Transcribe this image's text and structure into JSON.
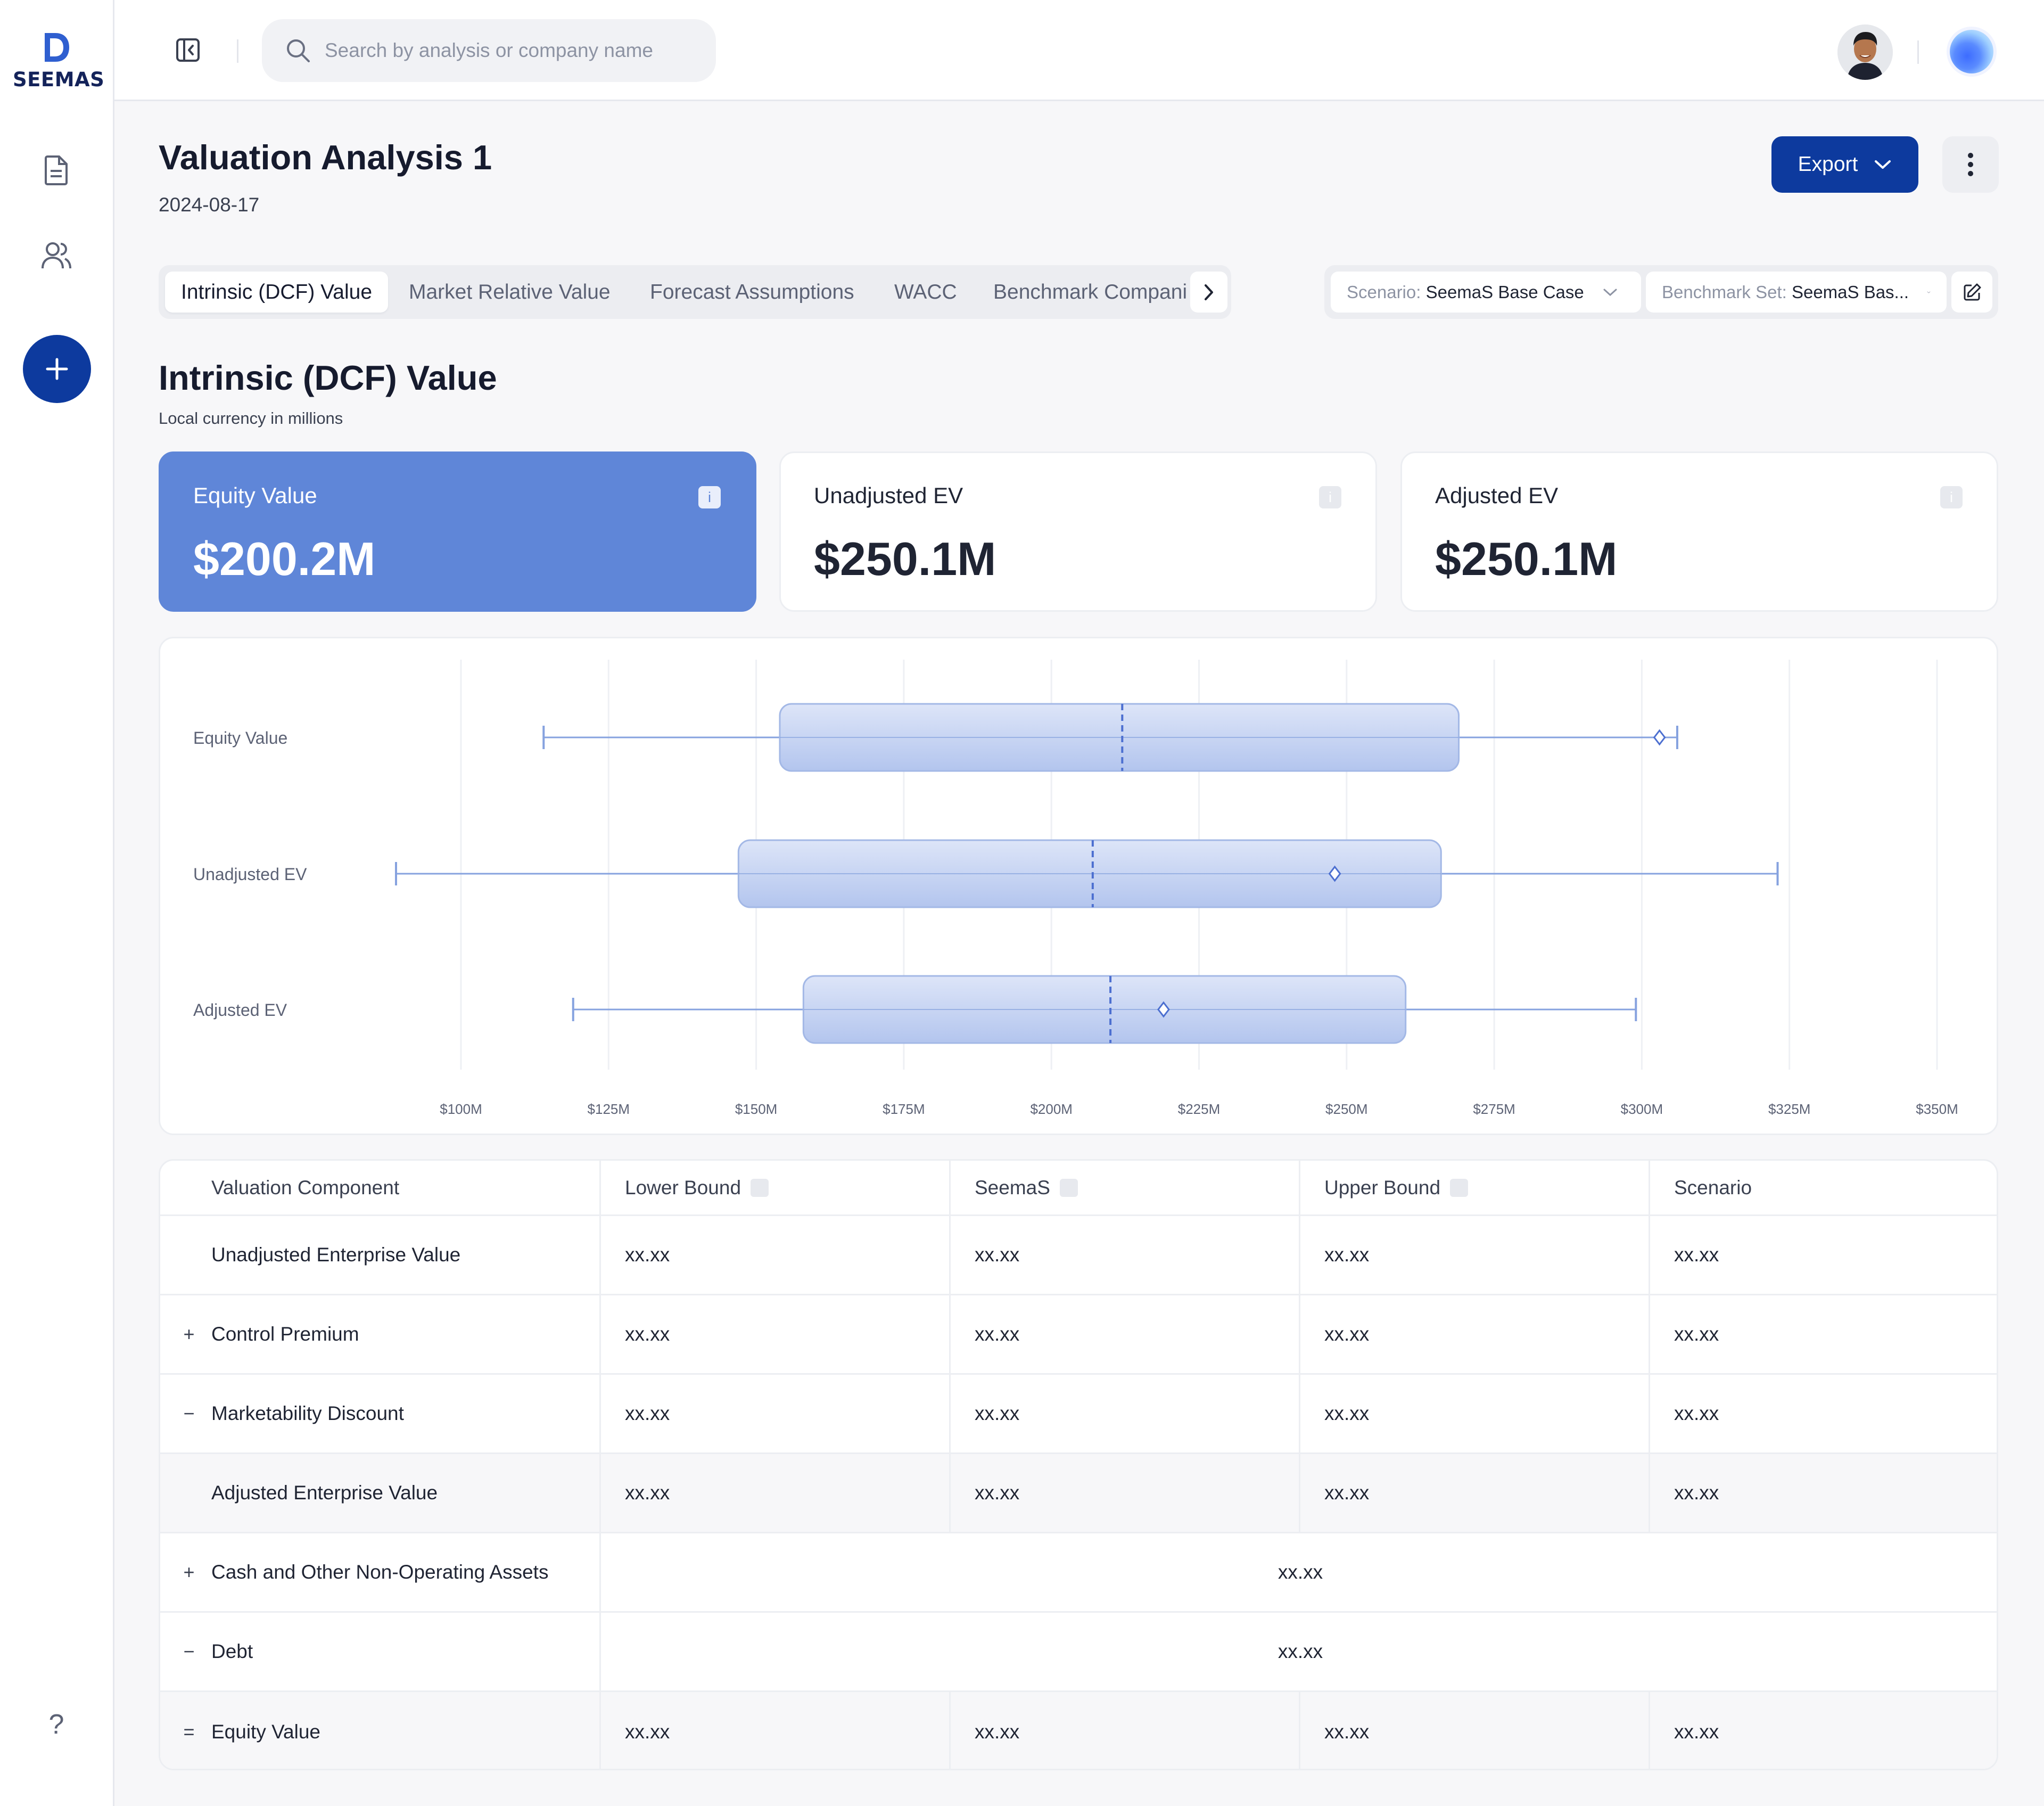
{
  "app": {
    "logo_text": "SEEMAS",
    "search_placeholder": "Search by analysis or company name"
  },
  "page": {
    "title": "Valuation Analysis 1",
    "date": "2024-08-17",
    "export_label": "Export"
  },
  "tabs": [
    {
      "label": "Intrinsic (DCF) Value",
      "active": true
    },
    {
      "label": "Market Relative Value",
      "active": false
    },
    {
      "label": "Forecast Assumptions",
      "active": false
    },
    {
      "label": "WACC",
      "active": false
    },
    {
      "label": "Benchmark Compani",
      "active": false
    }
  ],
  "filters": {
    "scenario_label": "Scenario:",
    "scenario_value": "SeemaS Base Case",
    "benchmark_label": "Benchmark Set:",
    "benchmark_value": "SeemaS Bas..."
  },
  "section": {
    "title": "Intrinsic (DCF) Value",
    "subtitle": "Local currency in millions"
  },
  "kpis": [
    {
      "label": "Equity Value",
      "value": "$200.2M",
      "info": "i"
    },
    {
      "label": "Unadjusted EV",
      "value": "$250.1M",
      "info": "i"
    },
    {
      "label": "Adjusted EV",
      "value": "$250.1M",
      "info": "i"
    }
  ],
  "chart_data": {
    "type": "boxplot",
    "orientation": "horizontal",
    "categories": [
      "Equity Value",
      "Unadjusted EV",
      "Adjusted EV"
    ],
    "x_ticks": [
      "$100M",
      "$125M",
      "$150M",
      "$175M",
      "$200M",
      "$225M",
      "$250M",
      "$275M",
      "$300M",
      "$325M",
      "$350M"
    ],
    "xlim": [
      100,
      350
    ],
    "grid": true,
    "series": [
      {
        "category": "Equity Value",
        "min": 114,
        "q1": 154,
        "median": 212,
        "q3": 269,
        "max": 306,
        "mean": 303
      },
      {
        "category": "Unadjusted EV",
        "min": 89,
        "q1": 147,
        "median": 207,
        "q3": 266,
        "max": 323,
        "mean": 248
      },
      {
        "category": "Adjusted EV",
        "min": 119,
        "q1": 158,
        "median": 210,
        "q3": 260,
        "max": 299,
        "mean": 219
      }
    ],
    "colors": {
      "box_fill": "#C9D6F3",
      "box_stroke": "#A3B8E6",
      "line": "#86A2DF",
      "median": "#4C6FD0",
      "grid": "#EEF0F4"
    }
  },
  "table": {
    "headers": [
      "Valuation Component",
      "Lower Bound",
      "SeemaS",
      "Upper Bound",
      "Scenario"
    ],
    "rows": [
      {
        "sign": "",
        "label": "Unadjusted Enterprise Value",
        "values": [
          "xx.xx",
          "xx.xx",
          "xx.xx",
          "xx.xx"
        ]
      },
      {
        "sign": "+",
        "label": "Control Premium",
        "values": [
          "xx.xx",
          "xx.xx",
          "xx.xx",
          "xx.xx"
        ]
      },
      {
        "sign": "−",
        "label": "Marketability Discount",
        "values": [
          "xx.xx",
          "xx.xx",
          "xx.xx",
          "xx.xx"
        ]
      },
      {
        "sign": "",
        "label": "Adjusted Enterprise Value",
        "values": [
          "xx.xx",
          "xx.xx",
          "xx.xx",
          "xx.xx"
        ]
      },
      {
        "sign": "+",
        "label": "Cash and Other Non-Operating Assets",
        "span_value": "xx.xx"
      },
      {
        "sign": "−",
        "label": "Debt",
        "span_value": "xx.xx"
      },
      {
        "sign": "=",
        "label": "Equity Value",
        "values": [
          "xx.xx",
          "xx.xx",
          "xx.xx",
          "xx.xx"
        ]
      }
    ]
  },
  "help_label": "?"
}
